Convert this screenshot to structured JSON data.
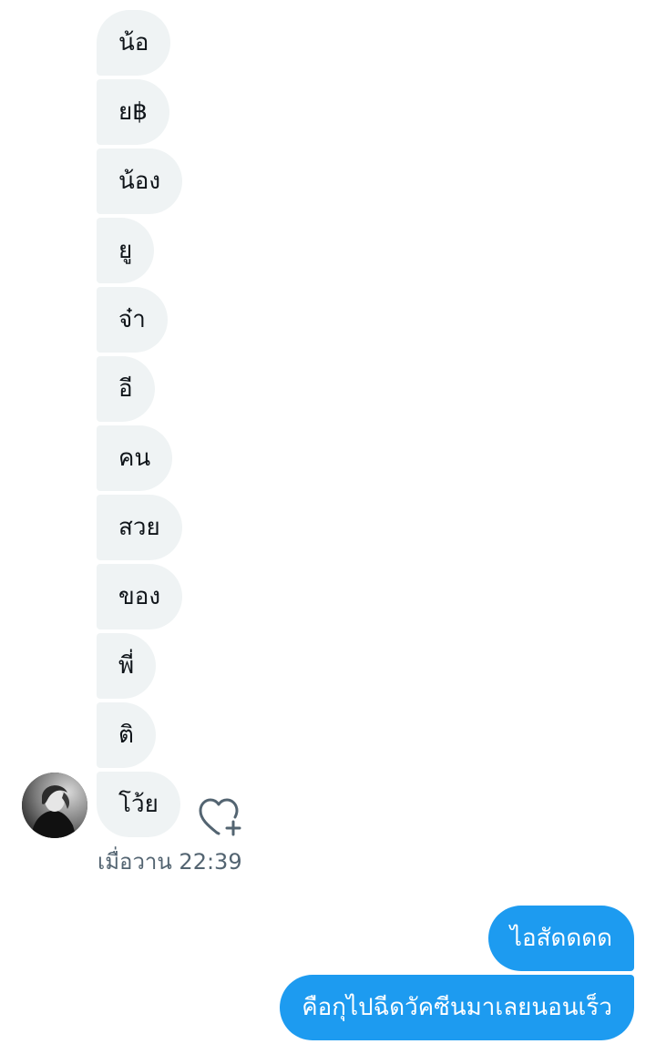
{
  "conversation": {
    "incoming": [
      {
        "text": "น้อ"
      },
      {
        "text": "ย฿"
      },
      {
        "text": "น้อง"
      },
      {
        "text": "ยู"
      },
      {
        "text": "จ๋า"
      },
      {
        "text": "อี"
      },
      {
        "text": "คน"
      },
      {
        "text": "สวย"
      },
      {
        "text": "ของ"
      },
      {
        "text": "พี่"
      },
      {
        "text": "ติ"
      },
      {
        "text": "โว้ย"
      }
    ],
    "incoming_timestamp": "เมื่อวาน 22:39",
    "outgoing": [
      {
        "text": "ไอสัดดดด"
      },
      {
        "text": "คือกุไปฉีดวัคซีนมาเลยนอนเร็ว"
      }
    ],
    "react_icon": "heart-plus-icon",
    "avatar_icon": "user-avatar",
    "colors": {
      "incoming_bubble": "#eff3f4",
      "outgoing_bubble": "#1d9bf0",
      "timestamp": "#536471",
      "text_dark": "#0f1419"
    }
  }
}
